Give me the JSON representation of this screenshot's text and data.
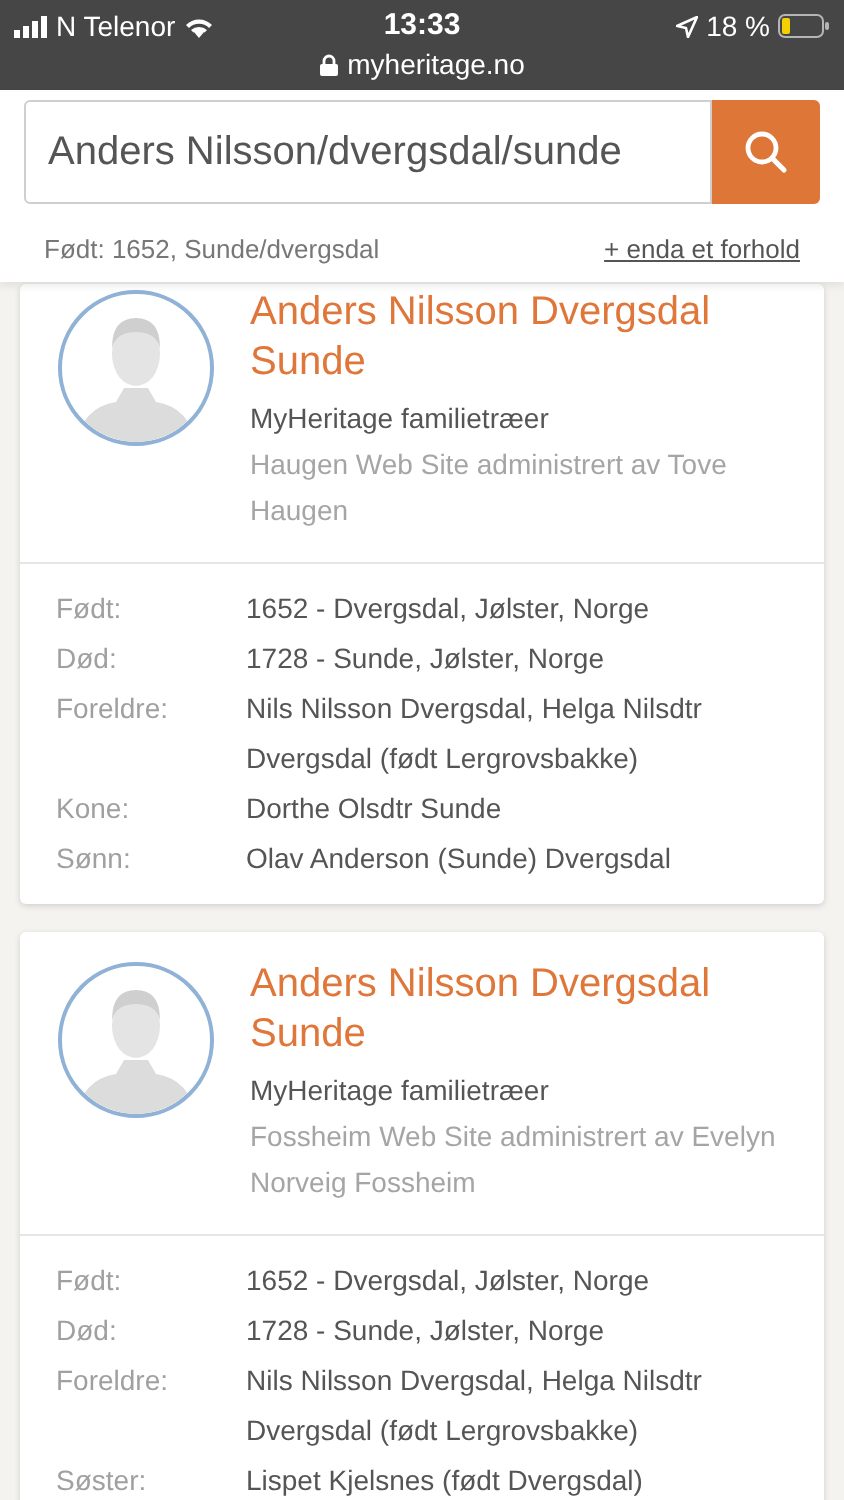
{
  "status_bar": {
    "carrier": "N Telenor",
    "time": "13:33",
    "url": "myheritage.no",
    "battery": "18 %"
  },
  "search": {
    "value": "Anders Nilsson/dvergsdal/sunde"
  },
  "filter": {
    "summary": "Født: 1652, Sunde/dvergsdal",
    "link": "+ enda et forhold"
  },
  "results": [
    {
      "name": "Anders Nilsson Dvergsdal Sunde",
      "source": "MyHeritage familietræer",
      "site": "Haugen Web Site administrert av Tove Haugen",
      "facts": [
        {
          "label": "Født:",
          "value": "1652 - Dvergsdal, Jølster, Norge"
        },
        {
          "label": "Død:",
          "value": "1728 - Sunde, Jølster, Norge"
        },
        {
          "label": "Foreldre:",
          "value": "Nils Nilsson Dvergsdal, Helga Nilsdtr Dvergsdal (født Lergrovsbakke)"
        },
        {
          "label": "Kone:",
          "value": "Dorthe Olsdtr Sunde"
        },
        {
          "label": "Sønn:",
          "value": "Olav Anderson (Sunde) Dvergsdal"
        }
      ]
    },
    {
      "name": "Anders Nilsson Dvergsdal Sunde",
      "source": "MyHeritage familietræer",
      "site": "Fossheim Web Site administrert av Evelyn Norveig Fossheim",
      "facts": [
        {
          "label": "Født:",
          "value": "1652 - Dvergsdal, Jølster, Norge"
        },
        {
          "label": "Død:",
          "value": "1728 - Sunde, Jølster, Norge"
        },
        {
          "label": "Foreldre:",
          "value": "Nils Nilsson Dvergsdal, Helga Nilsdtr Dvergsdal (født Lergrovsbakke)"
        },
        {
          "label": "Søster:",
          "value": "Lispet Kjelsnes (født Dvergsdal)"
        }
      ]
    }
  ]
}
